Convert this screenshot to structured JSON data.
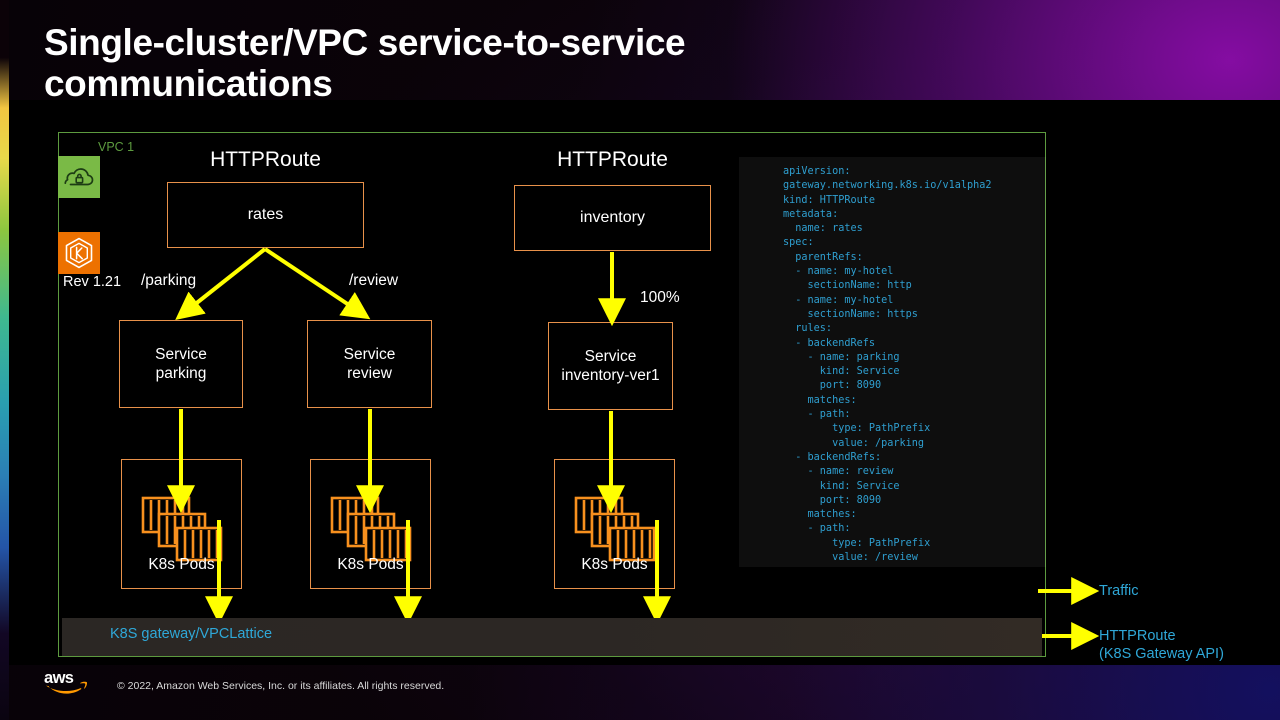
{
  "slide": {
    "title": "Single-cluster/VPC service-to-service communications",
    "colors": {
      "vpc_border": "#5d9b3f",
      "vpc_label": "#5d9b3f",
      "node_border": "#e8914a",
      "arrow": "#ffff00",
      "code_text": "#2f9fd0",
      "legend_text": "#2fa8d8",
      "vpc_icon_bg": "#7aba46",
      "eks_icon_bg": "#ed7100",
      "pod_icon": "#f7901e",
      "canvas": "#000000"
    }
  },
  "vpc": {
    "label": "VPC 1",
    "icons": {
      "vpc": "vpc-cloud-lock-icon",
      "eks": "eks-hexagon-k-icon"
    },
    "revision": "Rev 1.21"
  },
  "columns": [
    {
      "header": "HTTPRoute",
      "route_node": "rates"
    },
    {
      "header": "HTTPRoute",
      "route_node": "inventory"
    }
  ],
  "nodes": {
    "rates": "rates",
    "inventory": "inventory",
    "service_parking": "Service\nparking",
    "service_review": "Service\nreview",
    "service_inventory": "Service\ninventory-ver1",
    "pods_caption": "K8s Pods"
  },
  "edges": {
    "parking": "/parking",
    "review": "/review",
    "inventory_weight": "100%"
  },
  "gateway": {
    "label": "K8S gateway/VPCLattice"
  },
  "code": {
    "language": "yaml",
    "content": "apiVersion:\ngateway.networking.k8s.io/v1alpha2\nkind: HTTPRoute\nmetadata:\n  name: rates\nspec:\n  parentRefs:\n  - name: my-hotel\n    sectionName: http\n  - name: my-hotel\n    sectionName: https\n  rules:\n  - backendRefs\n    - name: parking\n      kind: Service\n      port: 8090\n    matches:\n    - path:\n        type: PathPrefix\n        value: /parking\n  - backendRefs:\n    - name: review\n      kind: Service\n      port: 8090\n    matches:\n    - path:\n        type: PathPrefix\n        value: /review"
  },
  "legend": [
    {
      "label": "Traffic"
    },
    {
      "label": "HTTPRoute\n(K8S Gateway API)"
    }
  ],
  "footer": {
    "logo": "aws-logo",
    "copyright": "© 2022, Amazon Web Services, Inc. or its affiliates. All rights reserved."
  }
}
